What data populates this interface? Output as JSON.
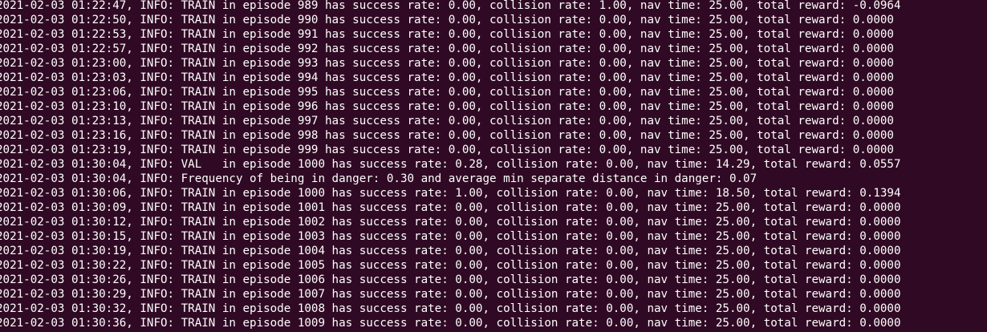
{
  "terminal": {
    "lines": [
      "2021-02-03 01:22:47, INFO: TRAIN in episode 989 has success rate: 0.00, collision rate: 1.00, nav time: 25.00, total reward: -0.0964",
      "2021-02-03 01:22:50, INFO: TRAIN in episode 990 has success rate: 0.00, collision rate: 0.00, nav time: 25.00, total reward: 0.0000",
      "2021-02-03 01:22:53, INFO: TRAIN in episode 991 has success rate: 0.00, collision rate: 0.00, nav time: 25.00, total reward: 0.0000",
      "2021-02-03 01:22:57, INFO: TRAIN in episode 992 has success rate: 0.00, collision rate: 0.00, nav time: 25.00, total reward: 0.0000",
      "2021-02-03 01:23:00, INFO: TRAIN in episode 993 has success rate: 0.00, collision rate: 0.00, nav time: 25.00, total reward: 0.0000",
      "2021-02-03 01:23:03, INFO: TRAIN in episode 994 has success rate: 0.00, collision rate: 0.00, nav time: 25.00, total reward: 0.0000",
      "2021-02-03 01:23:06, INFO: TRAIN in episode 995 has success rate: 0.00, collision rate: 0.00, nav time: 25.00, total reward: 0.0000",
      "2021-02-03 01:23:10, INFO: TRAIN in episode 996 has success rate: 0.00, collision rate: 0.00, nav time: 25.00, total reward: 0.0000",
      "2021-02-03 01:23:13, INFO: TRAIN in episode 997 has success rate: 0.00, collision rate: 0.00, nav time: 25.00, total reward: 0.0000",
      "2021-02-03 01:23:16, INFO: TRAIN in episode 998 has success rate: 0.00, collision rate: 0.00, nav time: 25.00, total reward: 0.0000",
      "2021-02-03 01:23:19, INFO: TRAIN in episode 999 has success rate: 0.00, collision rate: 0.00, nav time: 25.00, total reward: 0.0000",
      "2021-02-03 01:30:04, INFO: VAL   in episode 1000 has success rate: 0.28, collision rate: 0.00, nav time: 14.29, total reward: 0.0557",
      "2021-02-03 01:30:04, INFO: Frequency of being in danger: 0.30 and average min separate distance in danger: 0.07",
      "2021-02-03 01:30:06, INFO: TRAIN in episode 1000 has success rate: 1.00, collision rate: 0.00, nav time: 18.50, total reward: 0.1394",
      "2021-02-03 01:30:09, INFO: TRAIN in episode 1001 has success rate: 0.00, collision rate: 0.00, nav time: 25.00, total reward: 0.0000",
      "2021-02-03 01:30:12, INFO: TRAIN in episode 1002 has success rate: 0.00, collision rate: 0.00, nav time: 25.00, total reward: 0.0000",
      "2021-02-03 01:30:15, INFO: TRAIN in episode 1003 has success rate: 0.00, collision rate: 0.00, nav time: 25.00, total reward: 0.0000",
      "2021-02-03 01:30:19, INFO: TRAIN in episode 1004 has success rate: 0.00, collision rate: 0.00, nav time: 25.00, total reward: 0.0000",
      "2021-02-03 01:30:22, INFO: TRAIN in episode 1005 has success rate: 0.00, collision rate: 0.00, nav time: 25.00, total reward: 0.0000",
      "2021-02-03 01:30:26, INFO: TRAIN in episode 1006 has success rate: 0.00, collision rate: 0.00, nav time: 25.00, total reward: 0.0000",
      "2021-02-03 01:30:29, INFO: TRAIN in episode 1007 has success rate: 0.00, collision rate: 0.00, nav time: 25.00, total reward: 0.0000",
      "2021-02-03 01:30:32, INFO: TRAIN in episode 1008 has success rate: 0.00, collision rate: 0.00, nav time: 25.00, total reward: 0.0000",
      "2021-02-03 01:30:36, INFO: TRAIN in episode 1009 has success rate: 0.00, collision rate: 0.00, nav time: 25.00, total reward: 0.0000"
    ],
    "colors": {
      "background": "#300a24",
      "text": "#ffffff"
    }
  }
}
